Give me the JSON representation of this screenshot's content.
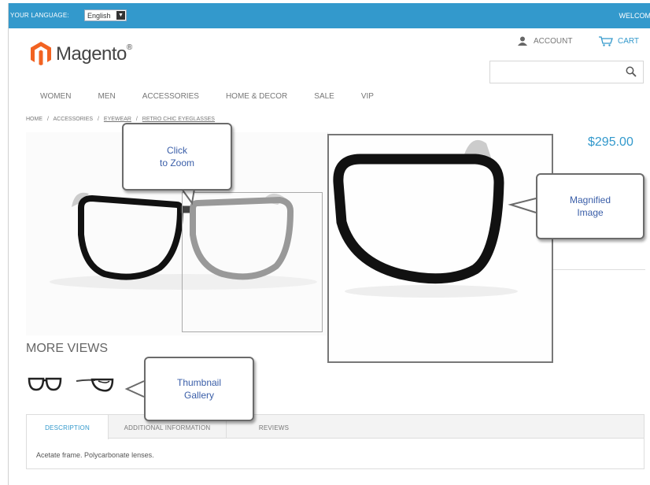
{
  "header": {
    "language_label": "YOUR LANGUAGE:",
    "language_value": "English",
    "welcome": "WELCOM"
  },
  "logo": {
    "text": "Magento",
    "registered": "®"
  },
  "account": {
    "label": "ACCOUNT",
    "icon": "person-icon"
  },
  "cart": {
    "label": "CART",
    "icon": "cart-icon"
  },
  "search": {
    "placeholder": "",
    "icon": "search-icon"
  },
  "nav": {
    "items": [
      "WOMEN",
      "MEN",
      "ACCESSORIES",
      "HOME & DECOR",
      "SALE",
      "VIP"
    ]
  },
  "breadcrumb": {
    "items": [
      "HOME",
      "/",
      "ACCESSORIES",
      "/",
      "EYEWEAR",
      "/",
      "RETRO CHIC EYEGLASSES"
    ]
  },
  "product": {
    "price": "$295.00"
  },
  "more_views": {
    "title": "MORE VIEWS"
  },
  "tabs": {
    "items": [
      "DESCRIPTION",
      "ADDITIONAL INFORMATION",
      "REVIEWS"
    ],
    "content": "Acetate frame. Polycarbonate lenses."
  },
  "callouts": {
    "zoom": "Click\nto Zoom",
    "magnified": "Magnified\nImage",
    "thumbnail": "Thumbnail\nGallery"
  },
  "colors": {
    "accent": "#3399cc",
    "logo_orange": "#f26322"
  }
}
